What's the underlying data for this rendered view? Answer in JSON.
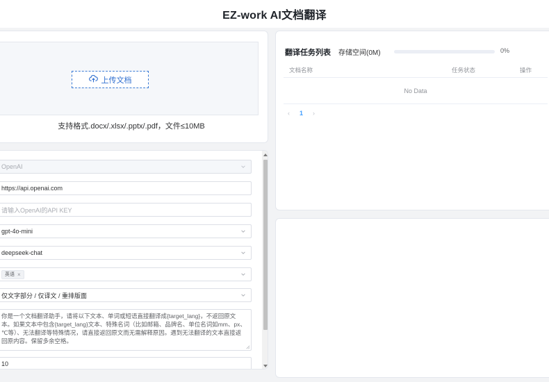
{
  "header": {
    "title": "EZ-work AI文档翻译"
  },
  "upload": {
    "button_label": "上传文档",
    "hint": "支持格式.docx/.xlsx/.pptx/.pdf，文件≤10MB"
  },
  "settings": {
    "provider": "OpenAI",
    "api_url": "https://api.openai.com",
    "api_key_placeholder": "请输入OpenAI的API KEY",
    "model": "gpt-4o-mini",
    "backup_model": "deepseek-chat",
    "target_lang_tag": "英语",
    "translate_mode": "仅文字部分 / 仅译文 / 重排版面",
    "prompt": "你是一个文档翻译助手，请将以下文本、单词或短语直接翻译成{target_lang}，不返回原文本。如果文本中包含{target_lang}文本、特殊名词（比如邮箱、品牌名、单位名词如mm、px、℃等）、无法翻译等特殊情况，请直接返回原文而无需解释原因。遇到无法翻译的文本直接返回原内容。保留多余空格。",
    "threads": "10"
  },
  "tasks": {
    "title": "翻译任务列表",
    "storage_label": "存储空间(0M)",
    "progress_percent": 0,
    "progress_text": "0%",
    "columns": [
      "文档名称",
      "任务状态",
      "操作"
    ],
    "empty_text": "No Data",
    "pager": {
      "prev": "‹",
      "current": "1",
      "next": "›"
    }
  },
  "icons": {
    "upload": "cloud-upload-icon",
    "select": "chevron-down-icon"
  },
  "colors": {
    "accent": "#409eff",
    "upload_border": "#3a7bd5"
  }
}
